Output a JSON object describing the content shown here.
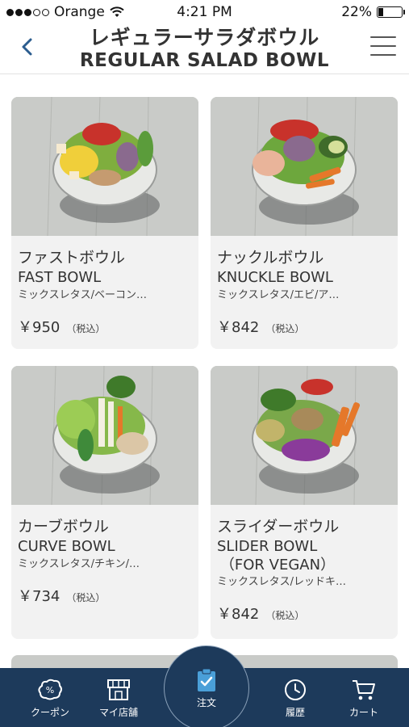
{
  "status_bar": {
    "carrier": "Orange",
    "time": "4:21 PM",
    "battery": "22%",
    "battery_level": 0.22
  },
  "header": {
    "title_ja": "レギュラーサラダボウル",
    "title_en": "REGULAR SALAD BOWL",
    "back_icon": "chevron-left-icon",
    "menu_icon": "hamburger-menu-icon"
  },
  "products": [
    {
      "name_ja": "ファストボウル",
      "name_en": "FAST BOWL",
      "desc": "ミックスレタス/ベーコン…",
      "price": "￥950",
      "tax": "（税込）"
    },
    {
      "name_ja": "ナックルボウル",
      "name_en": "KNUCKLE BOWL",
      "desc": "ミックスレタス/エビ/ア…",
      "price": "￥842",
      "tax": "（税込）"
    },
    {
      "name_ja": "カーブボウル",
      "name_en": "CURVE BOWL",
      "desc": "ミックスレタス/チキン/…",
      "price": "￥734",
      "tax": "（税込）"
    },
    {
      "name_ja": "スライダーボウル",
      "name_en": "SLIDER BOWL",
      "name_en_sub": "（FOR VEGAN）",
      "desc": "ミックスレタス/レッドキ…",
      "price": "￥842",
      "tax": "（税込）"
    }
  ],
  "nav": {
    "coupon": "クーポン",
    "my_store": "マイ店舗",
    "order": "注文",
    "history": "履歴",
    "cart": "カート"
  },
  "colors": {
    "nav_bg": "#1d3a5b",
    "accent": "#4a9fd8",
    "card_bg": "#f2f2f2"
  }
}
